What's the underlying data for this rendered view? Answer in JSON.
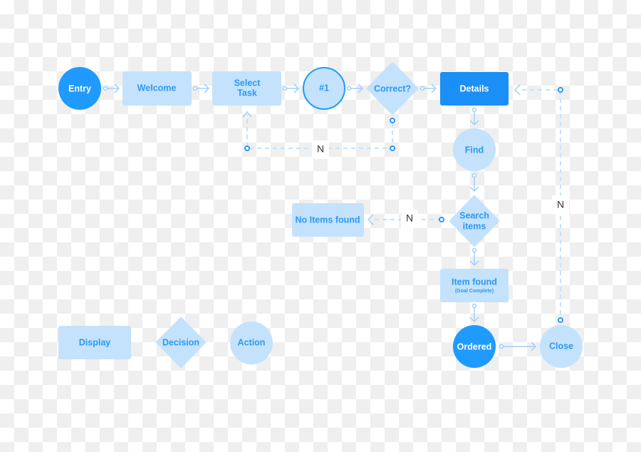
{
  "colors": {
    "primary": "#1f9bff",
    "light": "#c4e2fc",
    "text_light": "#2b98f4",
    "connector": "#9fd0fa"
  },
  "nodes": {
    "entry": "Entry",
    "welcome": "Welcome",
    "select_task": [
      "Select",
      "Task"
    ],
    "step1": "#1",
    "correct": "Correct?",
    "details": "Details",
    "find": "Find",
    "search_items": [
      "Search",
      "items"
    ],
    "no_items": "No Items found",
    "item_found": "Item found",
    "item_found_sub": "(Goal Complete)",
    "ordered": "Ordered",
    "close": "Close"
  },
  "edge_labels": {
    "correct_no": "N",
    "search_no": "N",
    "close_no": "N"
  },
  "legend": {
    "display": "Display",
    "decision": "Decision",
    "action": "Action"
  }
}
